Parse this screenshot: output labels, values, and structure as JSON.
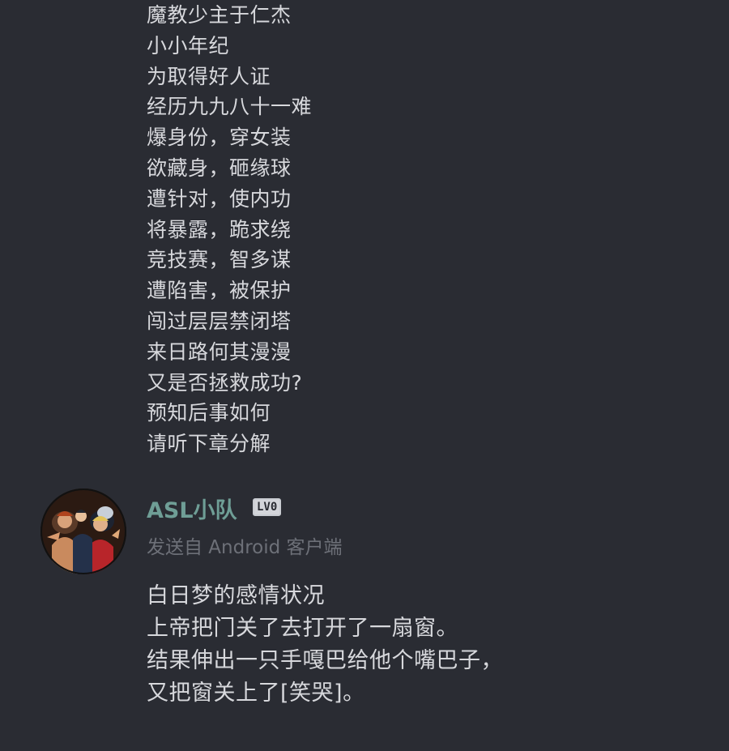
{
  "post": {
    "lines": [
      "魔教少主于仁杰",
      "小小年纪",
      "为取得好人证",
      "经历九九八十一难",
      "爆身份，穿女装",
      "欲藏身，砸缘球",
      "遭针对，使内功",
      "将暴露，跪求绕",
      "竞技赛，智多谋",
      "遭陷害，被保护",
      "闯过层层禁闭塔",
      "来日路何其漫漫",
      "又是否拯救成功?",
      "预知后事如何",
      "请听下章分解"
    ]
  },
  "reply": {
    "username": "ASL小队",
    "level": "LV0",
    "source": "发送自 Android 客户端",
    "lines": [
      "白日梦的感情状况",
      "上帝把门关了去打开了一扇窗。",
      "结果伸出一只手嘎巴给他个嘴巴子，",
      "又把窗关上了[笑哭]。"
    ],
    "colors": {
      "username": "#6f9e96",
      "text": "#d7d8dc",
      "meta": "#6d7078",
      "background": "#2a2c33"
    }
  }
}
